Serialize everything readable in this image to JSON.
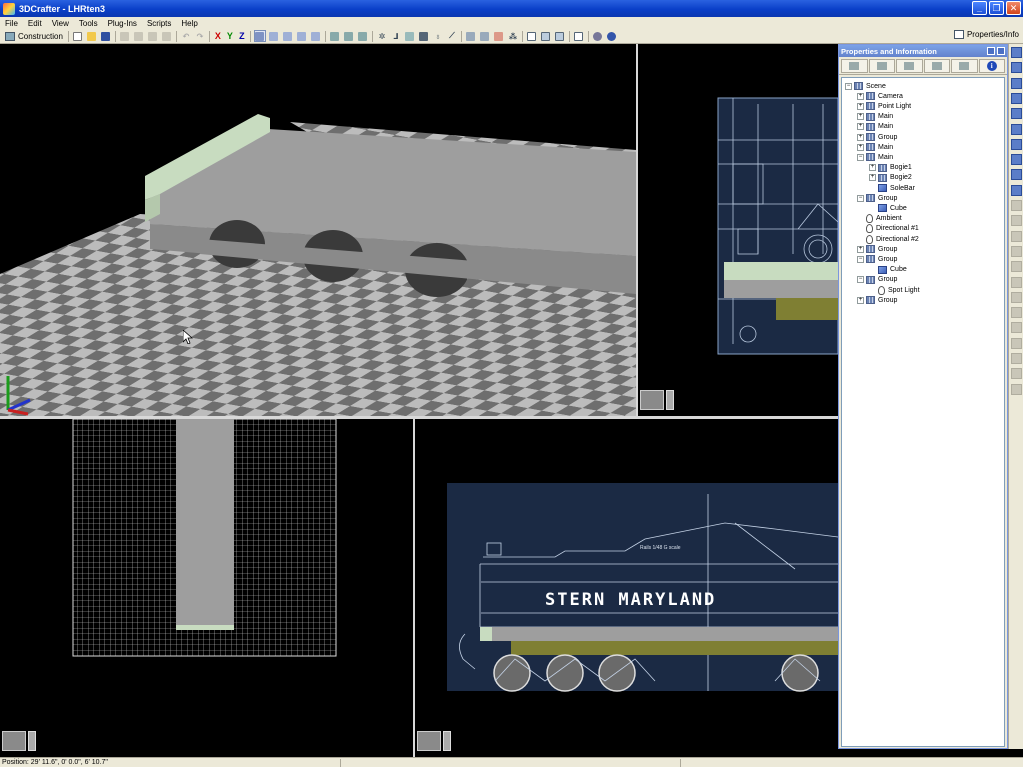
{
  "window": {
    "title": "3DCrafter - LHRten3"
  },
  "menu": [
    "File",
    "Edit",
    "View",
    "Tools",
    "Plug-Ins",
    "Scripts",
    "Help"
  ],
  "toolbar": {
    "mode_label": "Construction",
    "axis_x": "X",
    "axis_y": "Y",
    "axis_z": "Z",
    "properties_toggle": "Properties/Info"
  },
  "panel": {
    "title": "Properties and Information",
    "info_tab": "i",
    "tree": [
      {
        "label": "Scene",
        "depth": 0,
        "icon": "scene-icon",
        "expander": "−"
      },
      {
        "label": "Camera",
        "depth": 1,
        "icon": "group-icon",
        "expander": "+"
      },
      {
        "label": "Point Light",
        "depth": 1,
        "icon": "group-icon",
        "expander": "+"
      },
      {
        "label": "Main",
        "depth": 1,
        "icon": "group-icon",
        "expander": "+"
      },
      {
        "label": "Main",
        "depth": 1,
        "icon": "group-icon",
        "expander": "+"
      },
      {
        "label": "Group",
        "depth": 1,
        "icon": "group-icon",
        "expander": "+"
      },
      {
        "label": "Main",
        "depth": 1,
        "icon": "group-icon",
        "expander": "+"
      },
      {
        "label": "Main",
        "depth": 1,
        "icon": "group-icon",
        "expander": "−"
      },
      {
        "label": "Bogie1",
        "depth": 2,
        "icon": "group-icon",
        "expander": "+"
      },
      {
        "label": "Bogie2",
        "depth": 2,
        "icon": "group-icon",
        "expander": "+"
      },
      {
        "label": "SoleBar",
        "depth": 2,
        "icon": "cube-icon",
        "expander": ""
      },
      {
        "label": "Group",
        "depth": 1,
        "icon": "group-icon",
        "expander": "−"
      },
      {
        "label": "Cube",
        "depth": 2,
        "icon": "cube-icon",
        "expander": ""
      },
      {
        "label": "Ambient",
        "depth": 1,
        "icon": "light-icon",
        "expander": ""
      },
      {
        "label": "Directional #1",
        "depth": 1,
        "icon": "light-icon",
        "expander": ""
      },
      {
        "label": "Directional #2",
        "depth": 1,
        "icon": "light-icon",
        "expander": ""
      },
      {
        "label": "Group",
        "depth": 1,
        "icon": "group-icon",
        "expander": "+"
      },
      {
        "label": "Group",
        "depth": 1,
        "icon": "group-icon",
        "expander": "−"
      },
      {
        "label": "Cube",
        "depth": 2,
        "icon": "cube-icon",
        "expander": ""
      },
      {
        "label": "Group",
        "depth": 1,
        "icon": "group-icon",
        "expander": "−"
      },
      {
        "label": "Spot Light",
        "depth": 2,
        "icon": "light-icon",
        "expander": ""
      },
      {
        "label": "Group",
        "depth": 1,
        "icon": "group-icon",
        "expander": "+"
      }
    ]
  },
  "status": {
    "position": "Position: 29' 11.6\", 0' 0.0\", 6' 10.7\""
  },
  "blueprint": {
    "side_lettering": "STERN  MARYLAND",
    "note": "Rails 1/48\nG scale"
  },
  "colors": {
    "viewport_bg": "#000000",
    "model_gray": "#9e9e9e",
    "model_green": "#c8dcc0",
    "blueprint_bg": "#1b2a44",
    "checker_light": "#bcbcbc",
    "checker_dark": "#6e6e6e"
  }
}
